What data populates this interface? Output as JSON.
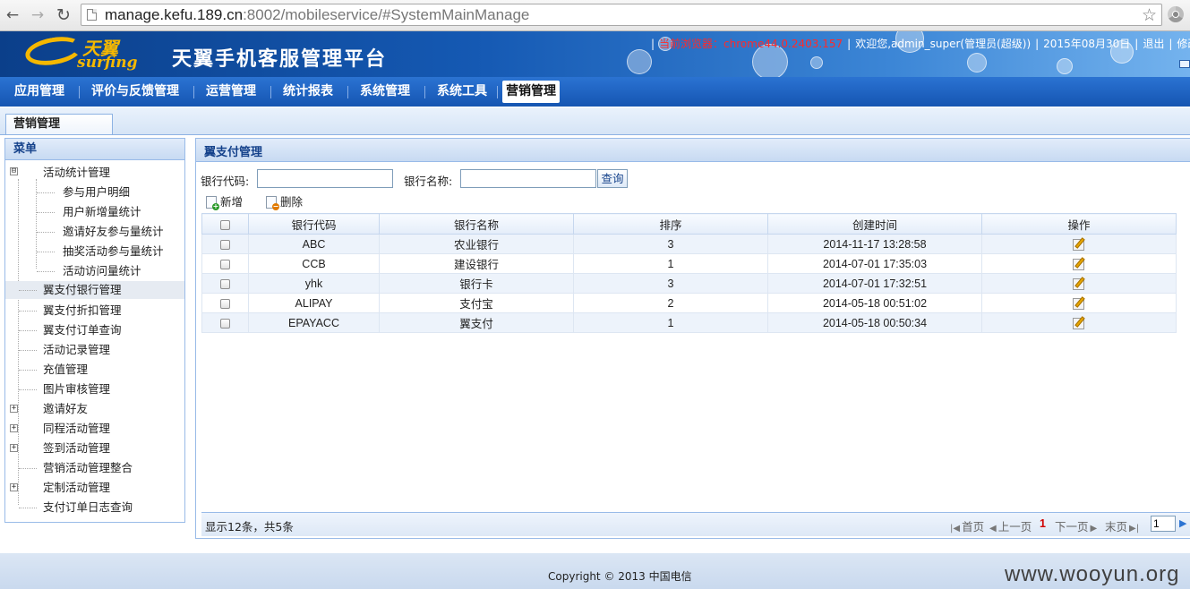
{
  "browser": {
    "url_host": "manage.kefu.189.cn",
    "url_rest": ":8002/mobileservice/#SystemMainManage"
  },
  "header": {
    "logo_cn": "天翼",
    "logo_en": "surfing",
    "platform_title": "天翼手机客服管理平台",
    "browser_info": "当前浏览器：chrome44.0.2403.157",
    "welcome": "欢迎您,admin_super(管理员(超级))",
    "date": "2015年08月30日",
    "logout": "退出",
    "modify": "修改"
  },
  "nav": {
    "items": [
      "应用管理",
      "评价与反馈管理",
      "运营管理",
      "统计报表",
      "系统管理",
      "系统工具",
      "营销管理"
    ],
    "active": "营销管理"
  },
  "tabs": {
    "active_tab": "营销管理"
  },
  "menu": {
    "title": "菜单",
    "items": [
      {
        "label": "活动统计管理",
        "toggle": "⊟"
      },
      {
        "label": "参与用户明细"
      },
      {
        "label": "用户新增量统计"
      },
      {
        "label": "邀请好友参与量统计"
      },
      {
        "label": "抽奖活动参与量统计"
      },
      {
        "label": "活动访问量统计"
      },
      {
        "label": "翼支付银行管理"
      },
      {
        "label": "翼支付折扣管理"
      },
      {
        "label": "翼支付订单查询"
      },
      {
        "label": "活动记录管理"
      },
      {
        "label": "充值管理"
      },
      {
        "label": "图片审核管理"
      },
      {
        "label": "邀请好友",
        "toggle": "+"
      },
      {
        "label": "同程活动管理",
        "toggle": "+"
      },
      {
        "label": "签到活动管理",
        "toggle": "+"
      },
      {
        "label": "营销活动管理整合"
      },
      {
        "label": "定制活动管理",
        "toggle": "+"
      },
      {
        "label": "支付订单日志查询"
      }
    ]
  },
  "content": {
    "title": "翼支付管理",
    "search": {
      "code_label": "银行代码:",
      "name_label": "银行名称:",
      "code_value": "",
      "name_value": "",
      "button": "查询"
    },
    "toolbar": {
      "add": "新增",
      "delete": "删除"
    },
    "table": {
      "headers": [
        "银行代码",
        "银行名称",
        "排序",
        "创建时间",
        "操作"
      ],
      "rows": [
        {
          "code": "ABC",
          "name": "农业银行",
          "sort": "3",
          "created": "2014-11-17 13:28:58"
        },
        {
          "code": "CCB",
          "name": "建设银行",
          "sort": "1",
          "created": "2014-07-01 17:35:03"
        },
        {
          "code": "yhk",
          "name": "银行卡",
          "sort": "3",
          "created": "2014-07-01 17:32:51"
        },
        {
          "code": "ALIPAY",
          "name": "支付宝",
          "sort": "2",
          "created": "2014-05-18 00:51:02"
        },
        {
          "code": "EPAYACC",
          "name": "翼支付",
          "sort": "1",
          "created": "2014-05-18 00:50:34"
        }
      ]
    },
    "pager": {
      "info": "显示12条，共5条",
      "first": "首页",
      "prev": "上一页",
      "current": "1",
      "next": "下一页",
      "last": "末页",
      "page_input": "1"
    }
  },
  "footer": {
    "copyright": "Copyright © 2013 中国电信",
    "watermark": "www.wooyun.org"
  },
  "colors": {
    "nav_blue": "#1555b2",
    "panel_border": "#99bbe8",
    "title_blue": "#15428b",
    "alert_red": "#ff2a2a"
  }
}
